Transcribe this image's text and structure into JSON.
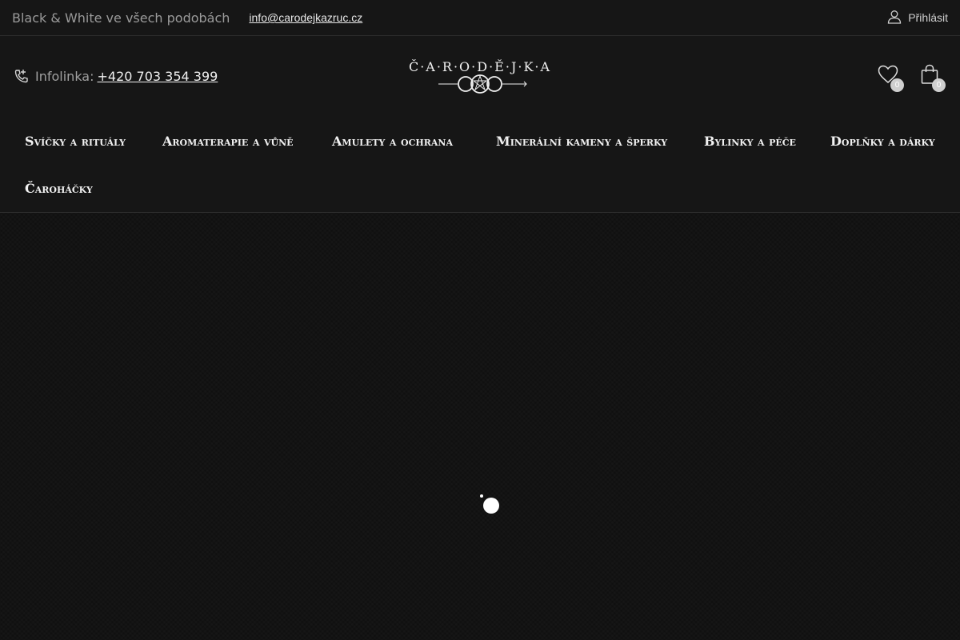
{
  "topbar": {
    "tagline": "Black & White ve všech podobách",
    "email": "info@carodejkazruc.cz",
    "login_label": "Přihlásit"
  },
  "header": {
    "infoline_label": "Infolinka:",
    "phone": "+420 703 354 399",
    "logo_text": "Č·A·R·O·D·Ě·J·K·A",
    "wishlist_count": "0",
    "cart_count": "0"
  },
  "nav": {
    "items": [
      {
        "label": "Svíčky a rituály"
      },
      {
        "label": "Aromaterapie a vůně"
      },
      {
        "label": "Amulety a ochrana"
      },
      {
        "label": "Minerální kameny a šperky"
      },
      {
        "label": "Bylinky a péče"
      },
      {
        "label": "Doplňky a dárky"
      },
      {
        "label": "Čaroháčky"
      }
    ]
  },
  "colors": {
    "background": "#141414",
    "text": "#f2f2f2",
    "muted": "#9a9a9a",
    "badge": "#cfcfcf"
  },
  "icons": {
    "phone": "phone-icon",
    "user": "user-icon",
    "wishlist": "heart-icon",
    "cart": "shopping-bag-icon"
  }
}
